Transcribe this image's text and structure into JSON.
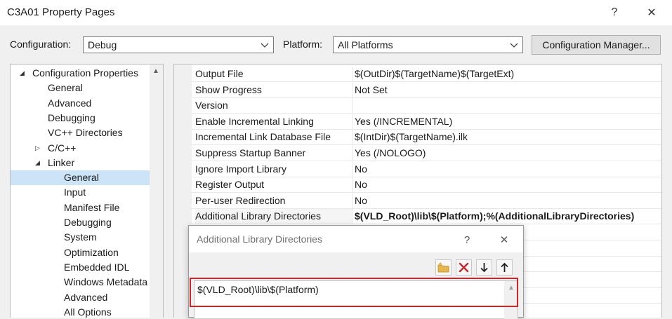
{
  "window": {
    "title": "C3A01 Property Pages",
    "help_glyph": "?",
    "close_glyph": "✕"
  },
  "toolbar": {
    "configuration_label": "Configuration:",
    "configuration_value": "Debug",
    "platform_label": "Platform:",
    "platform_value": "All Platforms",
    "config_manager_label": "Configuration Manager..."
  },
  "tree": {
    "items": [
      {
        "label": "Configuration Properties",
        "expander": "◢"
      },
      {
        "label": "General"
      },
      {
        "label": "Advanced"
      },
      {
        "label": "Debugging"
      },
      {
        "label": "VC++ Directories"
      },
      {
        "label": "C/C++",
        "expander": "▷"
      },
      {
        "label": "Linker",
        "expander": "◢"
      },
      {
        "label": "General",
        "selected": true
      },
      {
        "label": "Input"
      },
      {
        "label": "Manifest File"
      },
      {
        "label": "Debugging"
      },
      {
        "label": "System"
      },
      {
        "label": "Optimization"
      },
      {
        "label": "Embedded IDL"
      },
      {
        "label": "Windows Metadata"
      },
      {
        "label": "Advanced"
      },
      {
        "label": "All Options"
      }
    ]
  },
  "properties": {
    "rows": [
      {
        "name": "Output File",
        "value": "$(OutDir)$(TargetName)$(TargetExt)"
      },
      {
        "name": "Show Progress",
        "value": "Not Set"
      },
      {
        "name": "Version",
        "value": ""
      },
      {
        "name": "Enable Incremental Linking",
        "value": "Yes (/INCREMENTAL)"
      },
      {
        "name": "Incremental Link Database File",
        "value": "$(IntDir)$(TargetName).ilk"
      },
      {
        "name": "Suppress Startup Banner",
        "value": "Yes (/NOLOGO)"
      },
      {
        "name": "Ignore Import Library",
        "value": "No"
      },
      {
        "name": "Register Output",
        "value": "No"
      },
      {
        "name": "Per-user Redirection",
        "value": "No"
      },
      {
        "name": "Additional Library Directories",
        "value": "$(VLD_Root)\\lib\\$(Platform);%(AdditionalLibraryDirectories)",
        "bold": true
      }
    ]
  },
  "dialog": {
    "title": "Additional Library Directories",
    "help_glyph": "?",
    "close_glyph": "✕",
    "entries": [
      "$(VLD_Root)\\lib\\$(Platform)"
    ],
    "highlight_color": "#d1232a"
  }
}
